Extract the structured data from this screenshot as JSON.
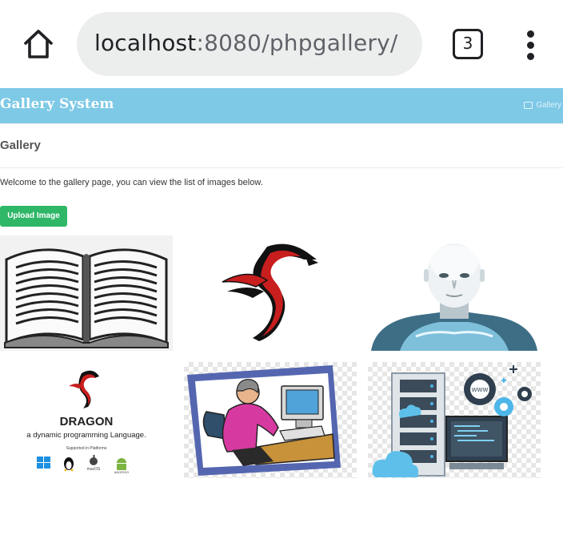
{
  "browser": {
    "url_host": "localhost",
    "url_rest": ":8080/phpgallery/",
    "tab_count": "3",
    "icons": {
      "home": "home-icon",
      "menu": "more-vert-icon"
    }
  },
  "header": {
    "brand": "Gallery System",
    "nav_link": "Gallery",
    "nav_icon": "image-icon",
    "background_color": "#7ec9e6"
  },
  "main": {
    "heading": "Gallery",
    "intro": "Welcome to the gallery page, you can view the list of images below.",
    "upload_button": "Upload Image",
    "upload_button_color": "#2fb768"
  },
  "gallery": {
    "images": [
      {
        "subject": "open book drawing"
      },
      {
        "subject": "red and black dragon emblem"
      },
      {
        "subject": "humanoid robot bust"
      },
      {
        "subject": "Dragon language logo",
        "title": "DRAGON",
        "tagline": "a dynamic programming Language.",
        "supported": "Supported in Platforms",
        "platforms": [
          "macOS",
          "ANDROID"
        ]
      },
      {
        "subject": "person working at computer clipart"
      },
      {
        "subject": "server rack, cloud and gears illustration",
        "badge": "WWW"
      }
    ]
  }
}
